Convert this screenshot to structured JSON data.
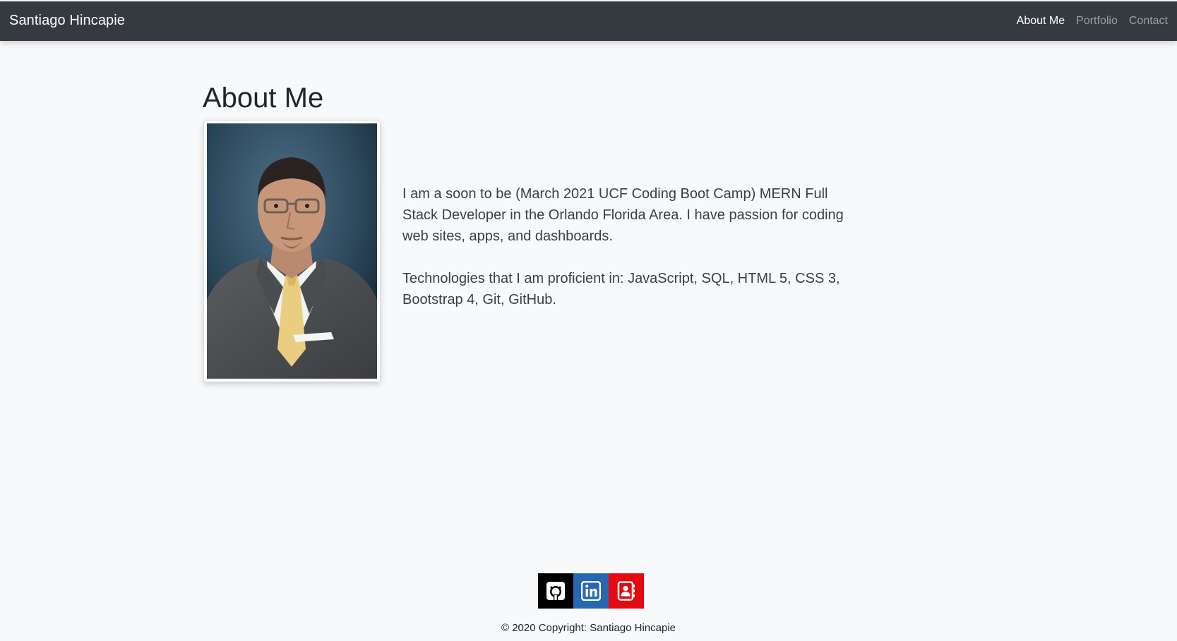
{
  "navbar": {
    "brand": "Santiago Hincapie",
    "links": [
      {
        "label": "About Me",
        "active": true
      },
      {
        "label": "Portfolio",
        "active": false
      },
      {
        "label": "Contact",
        "active": false
      }
    ]
  },
  "main": {
    "title": "About Me",
    "bio_paragraphs": [
      "I am a soon to be (March 2021 UCF Coding Boot Camp) MERN Full Stack Developer in the Orlando Florida Area. I have passion for coding web sites, apps, and dashboards.",
      "Technologies that I am proficient in: JavaScript, SQL, HTML 5, CSS 3, Bootstrap 4, Git, GitHub."
    ]
  },
  "footer": {
    "social": [
      {
        "icon": "github-icon",
        "color": "#000000"
      },
      {
        "icon": "linkedin-icon",
        "color": "#2867b2"
      },
      {
        "icon": "contact-book-icon",
        "color": "#e50914"
      }
    ],
    "copyright": "© 2020 Copyright: Santiago Hincapie"
  },
  "colors": {
    "navbar_bg": "#343a40",
    "page_bg": "#f8f9fa"
  }
}
